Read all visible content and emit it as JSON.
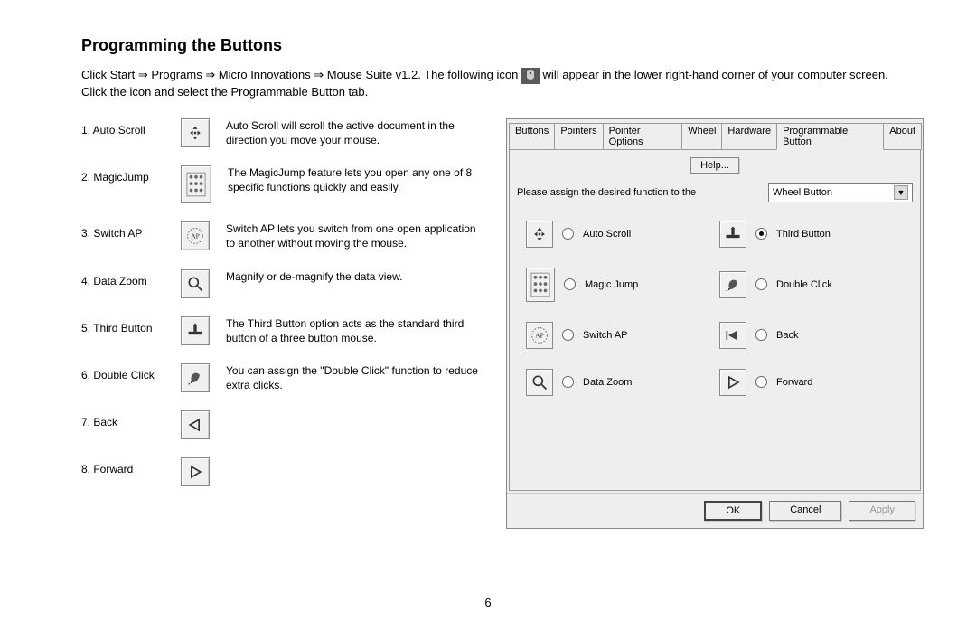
{
  "title": "Programming the Buttons",
  "intro_pre": "Click Start ⇒ Programs ⇒ Micro Innovations ⇒ Mouse Suite v1.2. The following icon ",
  "intro_post": " will appear in the lower right-hand corner of your computer screen. Click the icon and select the Programmable Button tab.",
  "features": [
    {
      "label": "1. Auto Scroll",
      "icon": "autoscroll",
      "desc": "Auto Scroll will scroll the active document in the direction you move your mouse."
    },
    {
      "label": "2. MagicJump",
      "icon": "magicjump",
      "desc": "The MagicJump feature lets you open any one of 8 specific functions quickly and easily."
    },
    {
      "label": "3. Switch AP",
      "icon": "switchap",
      "desc": "Switch AP lets you switch from one open application to another without moving the mouse."
    },
    {
      "label": "4. Data Zoom",
      "icon": "zoom",
      "desc": "Magnify or de-magnify the data view."
    },
    {
      "label": "5. Third Button",
      "icon": "third",
      "desc": "The Third Button option acts as the standard third button of a three button mouse."
    },
    {
      "label": "6. Double Click",
      "icon": "dblclick",
      "desc": "You can assign the \"Double Click\" function to reduce extra clicks."
    },
    {
      "label": "7. Back",
      "icon": "back",
      "desc": ""
    },
    {
      "label": "8. Forward",
      "icon": "forward",
      "desc": ""
    }
  ],
  "dialog": {
    "tabs": [
      "Buttons",
      "Pointers",
      "Pointer Options",
      "Wheel",
      "Hardware",
      "Programmable Button",
      "About"
    ],
    "active_tab": "Programmable Button",
    "help_label": "Help...",
    "assign_label": "Please assign the desired function to the",
    "combo_value": "Wheel Button",
    "options_left": [
      {
        "icon": "autoscroll",
        "label": "Auto Scroll"
      },
      {
        "icon": "magicjump",
        "label": "Magic Jump"
      },
      {
        "icon": "switchap",
        "label": "Switch AP"
      },
      {
        "icon": "zoom",
        "label": "Data Zoom"
      }
    ],
    "options_right": [
      {
        "icon": "third",
        "label": "Third Button",
        "checked": true
      },
      {
        "icon": "dblclick",
        "label": "Double Click"
      },
      {
        "icon": "back",
        "label": "Back"
      },
      {
        "icon": "forward",
        "label": "Forward"
      }
    ],
    "buttons": {
      "ok": "OK",
      "cancel": "Cancel",
      "apply": "Apply"
    }
  },
  "page_number": "6"
}
